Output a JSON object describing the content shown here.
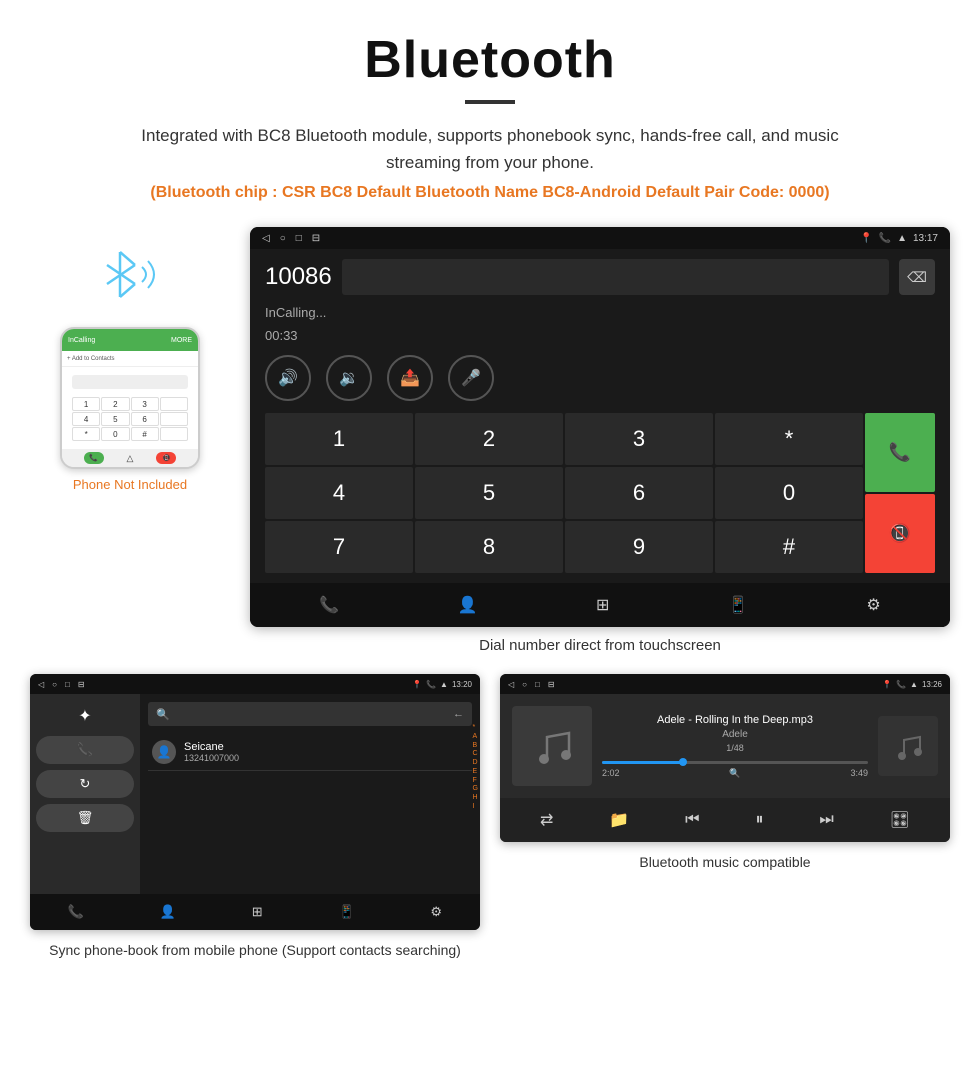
{
  "page": {
    "title": "Bluetooth",
    "divider": "—",
    "description": "Integrated with BC8 Bluetooth module, supports phonebook sync, hands-free call, and music streaming from your phone.",
    "orange_note": "(Bluetooth chip : CSR BC8    Default Bluetooth Name BC8-Android    Default Pair Code: 0000)"
  },
  "phone_section": {
    "not_included_label": "Phone Not Included"
  },
  "dial_screen": {
    "status_time": "13:17",
    "dial_number": "10086",
    "calling_label": "InCalling...",
    "timer": "00:33",
    "keys": [
      "1",
      "2",
      "3",
      "*",
      "4",
      "5",
      "6",
      "0",
      "7",
      "8",
      "9",
      "#"
    ],
    "call_green_icon": "📞",
    "call_red_icon": "📵"
  },
  "dial_caption": "Dial number direct from touchscreen",
  "phonebook_screen": {
    "status_time": "13:20",
    "contact_name": "Seicane",
    "contact_phone": "13241007000",
    "alphabet": [
      "*",
      "A",
      "B",
      "C",
      "D",
      "E",
      "F",
      "G",
      "H",
      "I"
    ]
  },
  "phonebook_caption": "Sync phone-book from mobile phone\n(Support contacts searching)",
  "music_screen": {
    "status_time": "13:26",
    "track_name": "Adele - Rolling In the Deep.mp3",
    "artist": "Adele",
    "count": "1/48",
    "time_current": "2:02",
    "time_total": "3:49",
    "progress_percent": 30
  },
  "music_caption": "Bluetooth music compatible"
}
